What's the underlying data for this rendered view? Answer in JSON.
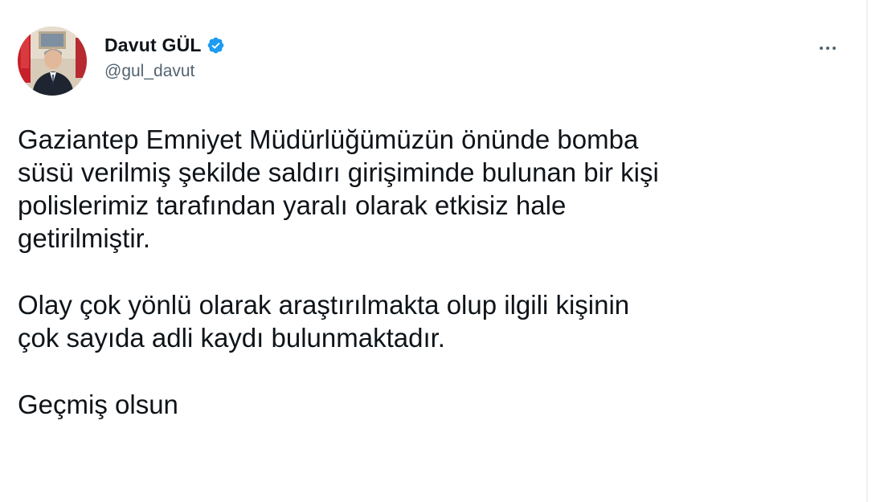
{
  "tweet": {
    "author": {
      "display_name": "Davut GÜL",
      "handle": "@gul_davut",
      "verified": true,
      "verified_color": "#1d9bf0",
      "avatar_icon": "profile-photo"
    },
    "more_icon": "more-horizontal-icon",
    "paragraphs": [
      "Gaziantep Emniyet Müdürlüğümüzün önünde bomba\nsüsü verilmiş şekilde saldırı girişiminde bulunan bir kişi\npolislerimiz tarafından yaralı olarak etkisiz hale\ngetirilmiştir.",
      "Olay çok yönlü olarak araştırılmakta olup ilgili kişinin\nçok sayıda adli kaydı bulunmaktadır.",
      "Geçmiş olsun"
    ]
  },
  "colors": {
    "text": "#0f1419",
    "secondary_text": "#536471",
    "accent": "#1d9bf0"
  }
}
